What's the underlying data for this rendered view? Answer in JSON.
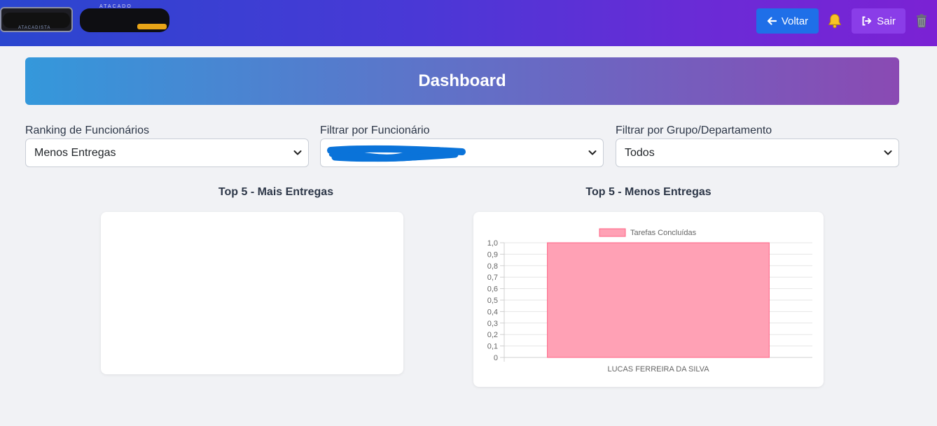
{
  "header": {
    "logo_left_sub": "ATACADISTA",
    "logo_right_sup": "ATACADO",
    "back_label": "Voltar",
    "exit_label": "Sair"
  },
  "dashboard": {
    "title": "Dashboard"
  },
  "filters": {
    "ranking": {
      "label": "Ranking de Funcionários",
      "value": "Menos Entregas"
    },
    "employee": {
      "label": "Filtrar por Funcionário",
      "value": ""
    },
    "group": {
      "label": "Filtrar por Grupo/Departamento",
      "value": "Todos"
    }
  },
  "charts": {
    "top_title": "Top 5 - Mais Entregas",
    "bottom_title": "Top 5 - Menos Entregas"
  },
  "colors": {
    "bar_fill": "#ffa1b5",
    "bar_stroke": "#ff6384"
  },
  "chart_data": [
    {
      "type": "bar",
      "title": "Top 5 - Mais Entregas",
      "categories": [],
      "series": []
    },
    {
      "type": "bar",
      "title": "Top 5 - Menos Entregas",
      "categories": [
        "LUCAS FERREIRA DA SILVA"
      ],
      "series": [
        {
          "name": "Tarefas Concluídas",
          "values": [
            1
          ]
        }
      ],
      "ylim": [
        0,
        1
      ],
      "yticks": [
        "0",
        "0,1",
        "0,2",
        "0,3",
        "0,4",
        "0,5",
        "0,6",
        "0,7",
        "0,8",
        "0,9",
        "1,0"
      ],
      "grid": true,
      "legend": "top"
    }
  ]
}
